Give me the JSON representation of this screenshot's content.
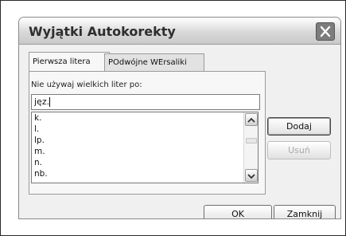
{
  "dialog": {
    "title": "Wyjątki Autokorekty"
  },
  "tabs": [
    "Pierwsza litera",
    "POdwójne WErsaliki"
  ],
  "panel": {
    "label": "Nie używaj wielkich liter po:",
    "input_value": "jęz.",
    "list_items": [
      "k.",
      "l.",
      "lp.",
      "m.",
      "n.",
      "nb."
    ]
  },
  "buttons": {
    "add": "Dodaj",
    "delete": "Usuń",
    "ok": "OK",
    "close": "Zamknij"
  },
  "icons": {
    "close": "close-icon",
    "scroll_up": "chevron-up-icon",
    "scroll_down": "chevron-down-icon"
  }
}
